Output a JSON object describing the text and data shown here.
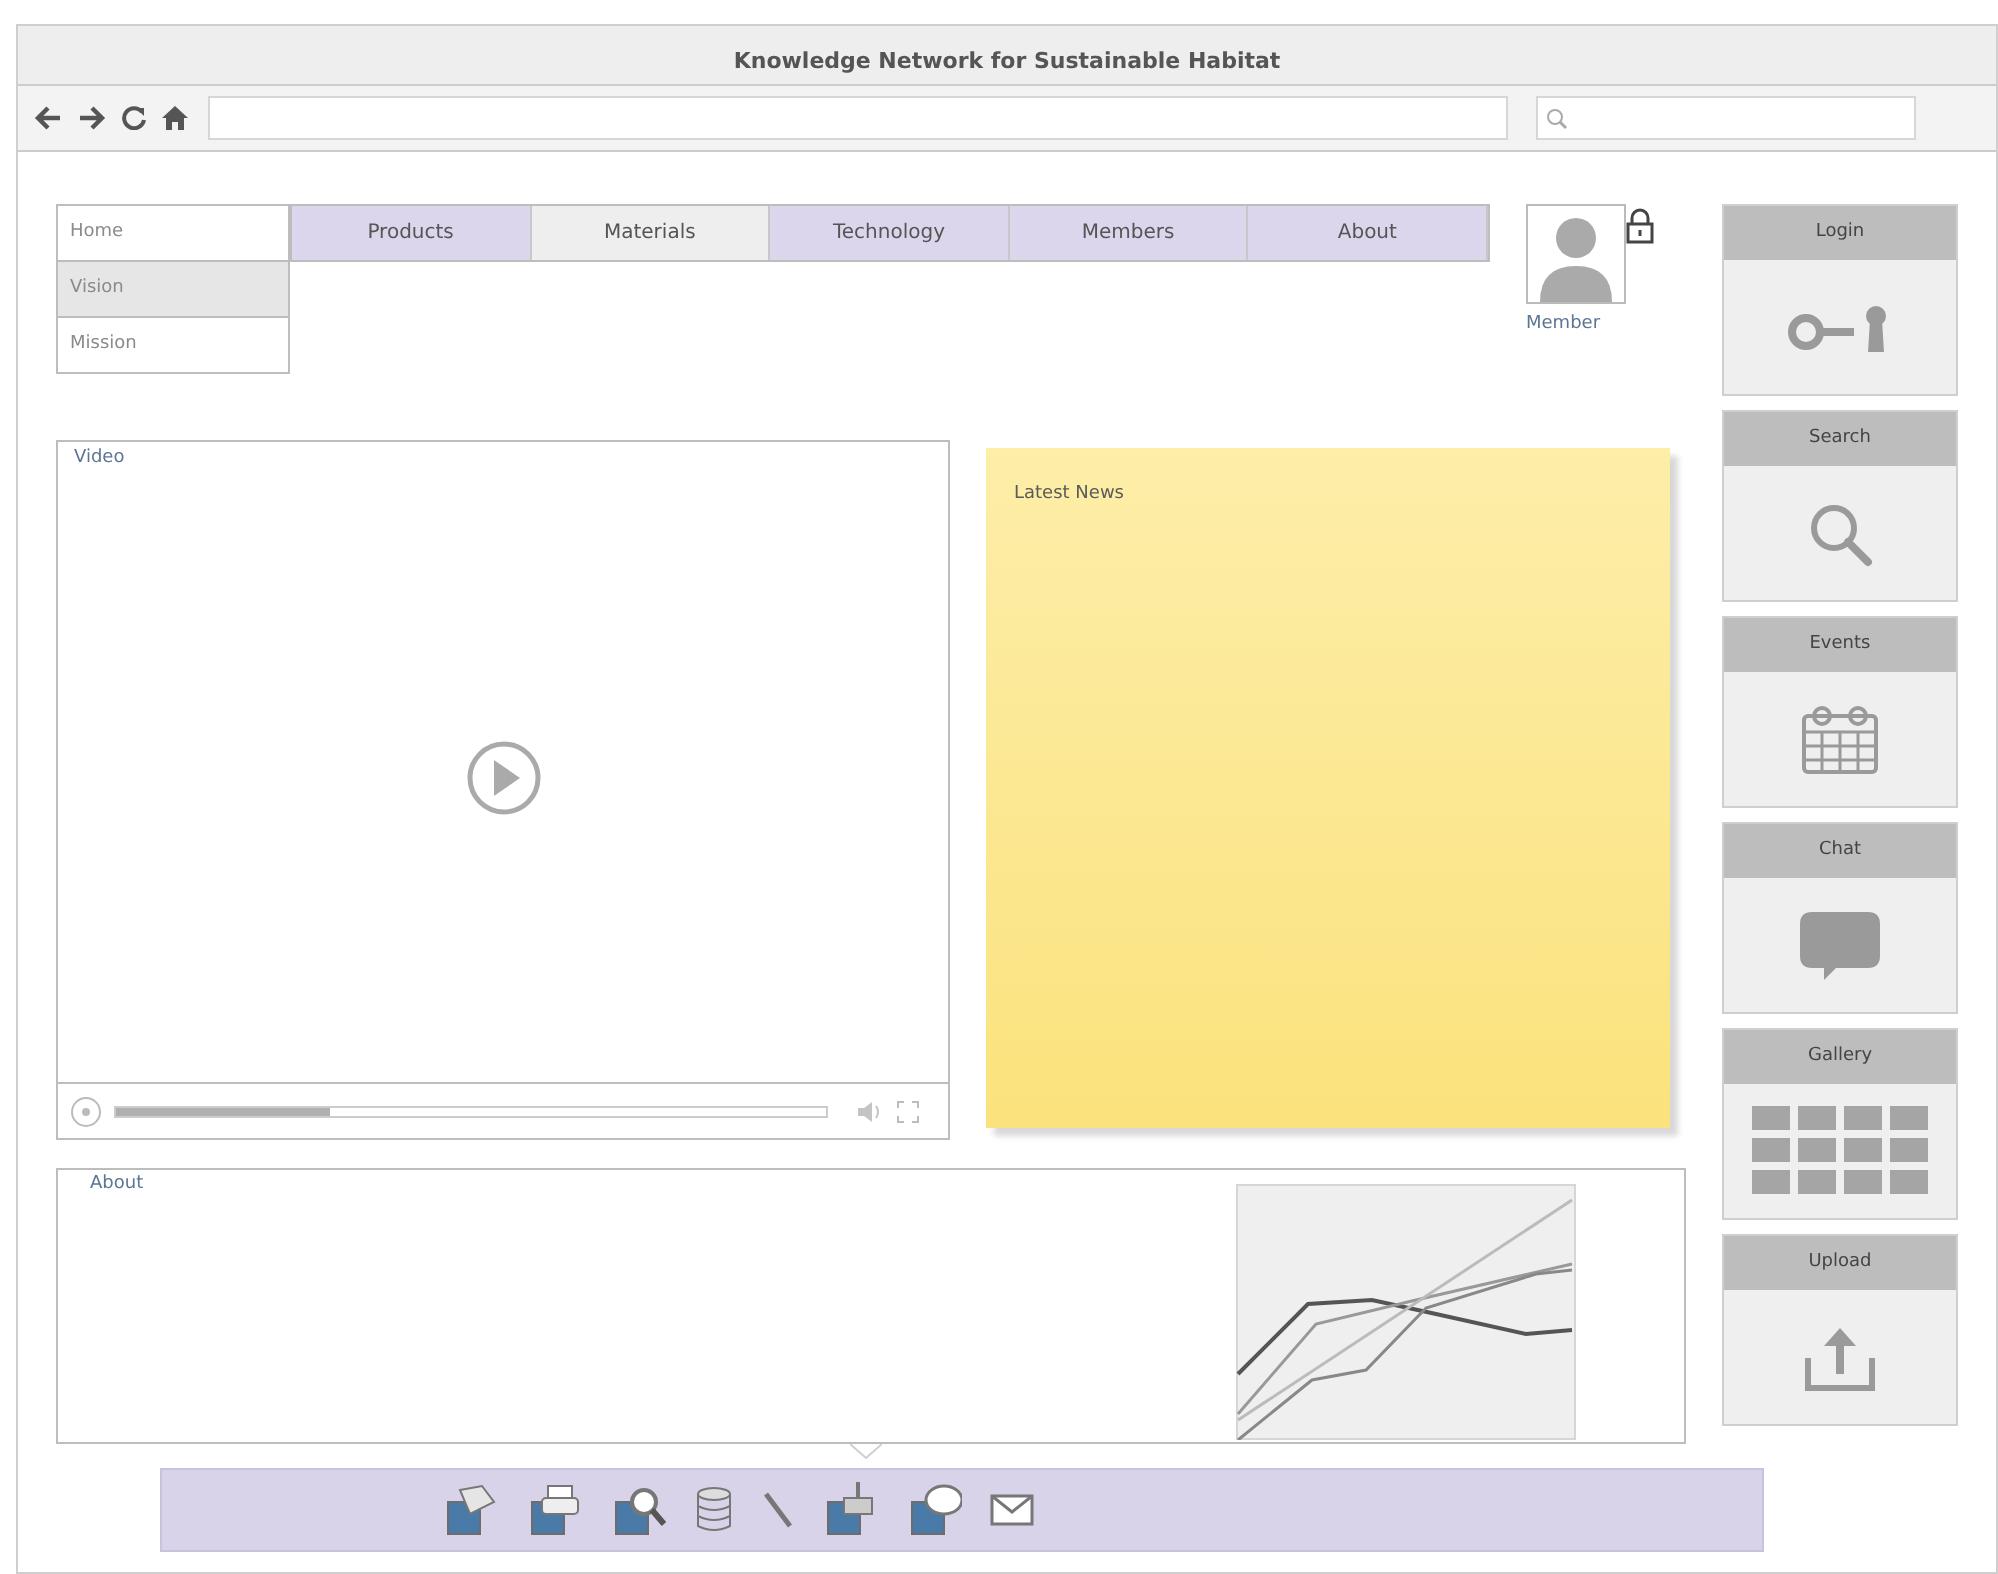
{
  "window": {
    "title": "Knowledge Network for Sustainable Habitat"
  },
  "side_menu": [
    {
      "label": "Home",
      "selected": false
    },
    {
      "label": "Vision",
      "selected": true
    },
    {
      "label": "Mission",
      "selected": false
    }
  ],
  "tabs": [
    {
      "label": "Products",
      "selected": false
    },
    {
      "label": "Materials",
      "selected": true
    },
    {
      "label": "Technology",
      "selected": false
    },
    {
      "label": "Members",
      "selected": false
    },
    {
      "label": "About",
      "selected": false
    }
  ],
  "member": {
    "label": "Member"
  },
  "video": {
    "title": "Video",
    "progress": {
      "level": 0.3
    }
  },
  "news": {
    "title": "Latest News"
  },
  "about": {
    "title": "About"
  },
  "sidebar": [
    {
      "label": "Login",
      "kind": "login"
    },
    {
      "label": "Search",
      "kind": "search"
    },
    {
      "label": "Events",
      "kind": "events"
    },
    {
      "label": "Chat",
      "kind": "chat"
    },
    {
      "label": "Gallery",
      "kind": "gallery"
    },
    {
      "label": "Upload",
      "kind": "upload"
    }
  ]
}
